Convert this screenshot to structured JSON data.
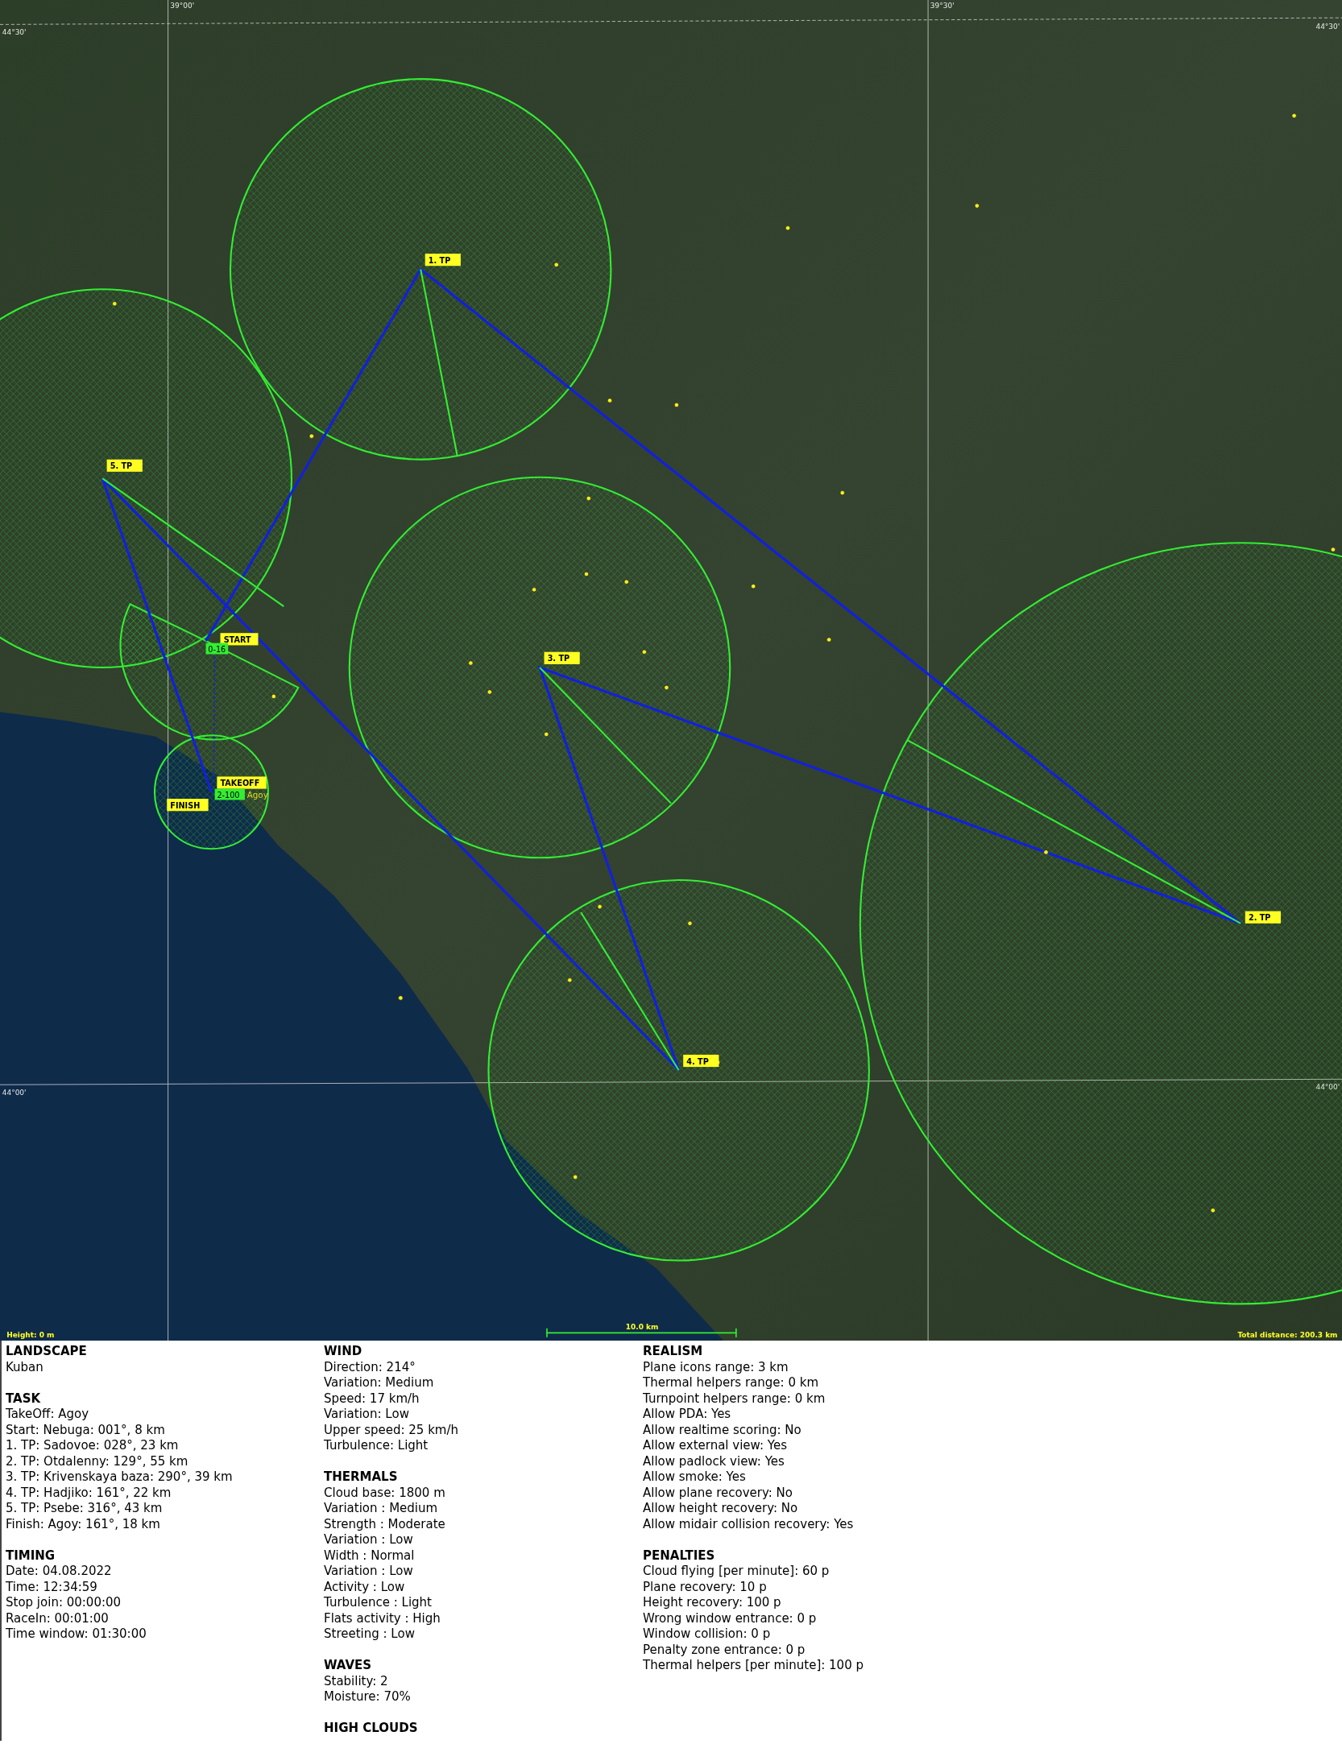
{
  "map": {
    "grid_labels": [
      "39°00'",
      "39°30'",
      "44°30'",
      "44°30'",
      "44°00'",
      "44°00'"
    ],
    "turnpoints": [
      {
        "label": "1. TP"
      },
      {
        "label": "2. TP"
      },
      {
        "label": "3. TP"
      },
      {
        "label": "4. TP"
      },
      {
        "label": "5. TP"
      }
    ],
    "start_label": "START",
    "takeoff_label": "TAKEOFF",
    "finish_label": "FINISH",
    "height_bands": [
      "0-16",
      "2-100"
    ],
    "place_label": "Agoy",
    "height": "Height: 0 m",
    "scale": "10.0 km",
    "total_distance": "Total distance: 200.3 km"
  },
  "briefing": {
    "columns": [
      [
        {
          "title": "LANDSCAPE",
          "lines": [
            "Kuban"
          ]
        },
        {
          "title": "TASK",
          "lines": [
            "TakeOff: Agoy",
            "Start: Nebuga: 001°, 8 km",
            "1. TP: Sadovoe: 028°, 23 km",
            "2. TP: Otdalenny: 129°, 55 km",
            "3. TP: Krivenskaya baza: 290°, 39 km",
            "4. TP: Hadjiko: 161°, 22 km",
            "5. TP: Psebe: 316°, 43 km",
            "Finish: Agoy: 161°, 18 km"
          ]
        },
        {
          "title": "TIMING",
          "lines": [
            "Date: 04.08.2022",
            "Time: 12:34:59",
            "Stop join: 00:00:00",
            "RaceIn: 00:01:00",
            "Time window: 01:30:00"
          ]
        }
      ],
      [
        {
          "title": "WIND",
          "lines": [
            "Direction: 214°",
            "Variation: Medium",
            "Speed: 17 km/h",
            "Variation: Low",
            "Upper speed: 25 km/h",
            "Turbulence: Light"
          ]
        },
        {
          "title": "THERMALS",
          "lines": [
            "Cloud base: 1800 m",
            "Variation : Medium",
            "Strength : Moderate",
            "Variation : Low",
            "Width : Normal",
            "Variation : Low",
            "Activity : Low",
            "Turbulence : Light",
            "Flats activity : High",
            "Streeting : Low"
          ]
        },
        {
          "title": "WAVES",
          "lines": [
            "Stability: 2",
            "Moisture: 70%"
          ]
        },
        {
          "title": "HIGH CLOUDS"
        }
      ],
      [
        {
          "title": "REALISM",
          "lines": [
            "Plane icons range: 3 km",
            "Thermal helpers range: 0 km",
            "Turnpoint helpers range: 0 km",
            "Allow PDA: Yes",
            "Allow realtime scoring: No",
            "Allow external view: Yes",
            "Allow padlock view: Yes",
            "Allow smoke: Yes",
            "Allow plane recovery: No",
            "Allow height recovery: No",
            "Allow midair collision recovery: Yes"
          ]
        },
        {
          "title": "PENALTIES",
          "lines": [
            "Cloud flying [per minute]: 60 p",
            "Plane recovery: 10 p",
            "Height recovery: 100 p",
            "Wrong window entrance: 0 p",
            "Window collision: 0 p",
            "Penalty zone entrance: 0 p",
            "Thermal helpers [per minute]: 100 p"
          ]
        }
      ]
    ]
  }
}
